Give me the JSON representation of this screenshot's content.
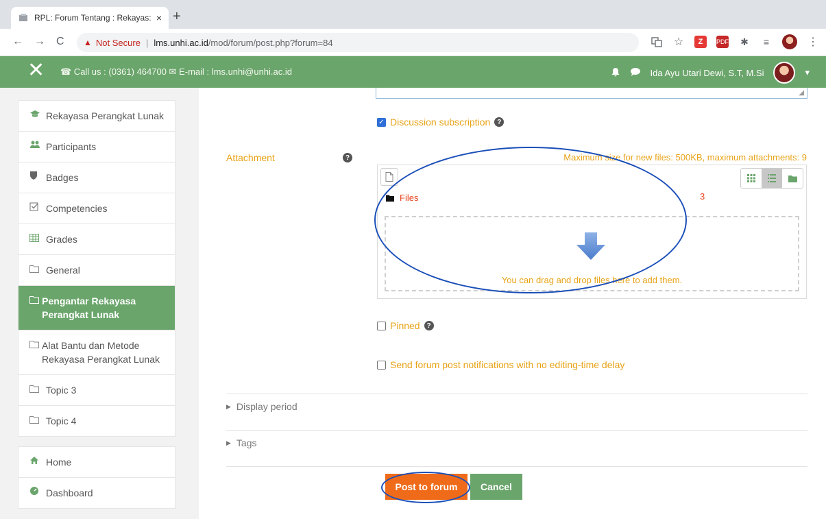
{
  "browser": {
    "tab_title": "RPL: Forum Tentang : Rekayas:",
    "tab_close": "×",
    "new_tab": "+",
    "back": "←",
    "forward": "→",
    "reload": "C",
    "warning_icon": "▲",
    "not_secure": "Not Secure",
    "separator": "|",
    "url_host": "lms.unhi.ac.id",
    "url_path": "/mod/forum/post.php?forum=84"
  },
  "header": {
    "close_glyph": "✕",
    "contact_text": "☎ Call us : (0361) 464700 ✉ E-mail : lms.unhi@unhi.ac.id",
    "user_name": "Ida Ayu Utari Dewi, S.T, M.Si",
    "bell": "🔔",
    "chat": "💬",
    "caret": "▾"
  },
  "sidebar": {
    "items": [
      {
        "icon": "🎓",
        "label": "Rekayasa Perangkat Lunak"
      },
      {
        "icon": "👥",
        "label": "Participants"
      },
      {
        "icon": "🛡",
        "label": "Badges"
      },
      {
        "icon": "☑",
        "label": "Competencies"
      },
      {
        "icon": "▦",
        "label": "Grades"
      },
      {
        "icon": "▭",
        "label": "General"
      },
      {
        "icon": "▭",
        "label": "Pengantar Rekayasa Perangkat Lunak"
      },
      {
        "icon": "▭",
        "label": "Alat Bantu dan Metode Rekayasa Perangkat Lunak"
      },
      {
        "icon": "▭",
        "label": "Topic 3"
      },
      {
        "icon": "▭",
        "label": "Topic 4"
      }
    ],
    "nav": [
      {
        "icon": "🏠",
        "label": "Home"
      },
      {
        "icon": "⚙",
        "label": "Dashboard"
      }
    ]
  },
  "form": {
    "discussion_subscription": "Discussion subscription",
    "attachment_label": "Attachment",
    "max_info": "Maximum size for new files: 500KB, maximum attachments: 9",
    "files_path": "Files",
    "files_count": "3",
    "drop_text": "You can drag and drop files here to add them.",
    "pinned": "Pinned",
    "send_notifications": "Send forum post notifications with no editing-time delay",
    "display_period": "Display period",
    "tags": "Tags",
    "post_button": "Post to forum",
    "cancel_button": "Cancel",
    "help_glyph": "?",
    "check_glyph": "✓"
  }
}
